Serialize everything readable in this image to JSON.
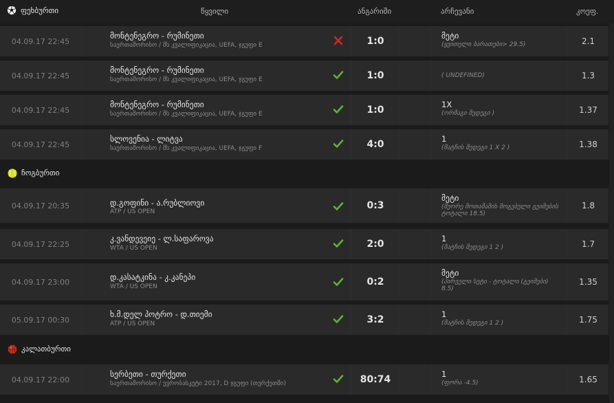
{
  "header": {
    "sport_label": "ფეხბურთი",
    "col_pair": "წყვილი",
    "col_score": "ანგარიში",
    "col_selection": "არჩევანი",
    "col_odd": "კოეფ."
  },
  "colors": {
    "won": "#5cb531",
    "lost": "#d9251d",
    "tennis_ball": "#d7e21a",
    "basketball": "#c7331f"
  },
  "football": [
    {
      "date": "04.09.17 22:45",
      "teams": "მონტენეგრო - რუმინეთი",
      "league": "საერთაშორისო / მს კვალიფიკაცია, UEFA, ჯგუფი E",
      "status": "lost",
      "score": "1:0",
      "sel": "მეტი",
      "desc": "(ყვითელი ბარათები> 29.5)",
      "odd": "2.1"
    },
    {
      "date": "04.09.17 22:45",
      "teams": "მონტენეგრო - რუმინეთი",
      "league": "საერთაშორისო / მს კვალიფიკაცია, UEFA, ჯგუფი E",
      "status": "won",
      "score": "1:0",
      "sel": "",
      "desc": "( UNDEFINED)",
      "odd": "1.3"
    },
    {
      "date": "04.09.17 22:45",
      "teams": "მონტენეგრო - რუმინეთი",
      "league": "საერთაშორისო / მს კვალიფიკაცია, UEFA, ჯგუფი E",
      "status": "won",
      "score": "1:0",
      "sel": "1X",
      "desc": "(ორმაგი შედეგი )",
      "odd": "1.37"
    },
    {
      "date": "04.09.17 22:45",
      "teams": "სლოვენია - ლიტვა",
      "league": "საერთაშორისო / მს კვალიფიკაცია, UEFA, ჯგუფი F",
      "status": "won",
      "score": "4:0",
      "sel": "1",
      "desc": "(მატჩის შედეგი 1 X 2 )",
      "odd": "1.38"
    }
  ],
  "tennis_label": "ჩოგბურთი",
  "tennis": [
    {
      "date": "04.09.17 20:35",
      "teams": "დ.გოფინი - ა.რუბლიოვი",
      "league": "ATP / US OPEN",
      "status": "won",
      "score": "0:3",
      "sel": "მეტი",
      "desc": "(მეორე მოთამაშის მოგებული გეიმების ტოტალი 18.5)",
      "odd": "1.8"
    },
    {
      "date": "04.09.17 22:25",
      "teams": "კ.ვანდევეიე - ლ.საფაროვა",
      "league": "WTA / US OPEN",
      "status": "won",
      "score": "2:0",
      "sel": "1",
      "desc": "(მატჩის შედეგი 1 2 )",
      "odd": "1.7"
    },
    {
      "date": "04.09.17 23:00",
      "teams": "დ.კასატკინა - კ.კანეპი",
      "league": "WTA / US OPEN",
      "status": "won",
      "score": "0:2",
      "sel": "მეტი",
      "desc": "(პირველი სეტი - ტოტალი (გეიმები) 8.5)",
      "odd": "1.35"
    },
    {
      "date": "05.09.17 00:30",
      "teams": "ხ.მ.დელ პოტრო - დ.თიემი",
      "league": "ATP / US OPEN",
      "status": "won",
      "score": "3:2",
      "sel": "1",
      "desc": "(მატჩის შედეგი 1 2 )",
      "odd": "1.75"
    }
  ],
  "basketball_label": "კალათბურთი",
  "basketball": [
    {
      "date": "04.09.17 22:00",
      "teams": "სერბეთი - თურქეთი",
      "league": "საერთაშორისო / ევრობასკეტი 2017, D ჯგუფი (თურქეთში)",
      "status": "won",
      "score": "80:74",
      "sel": "1",
      "desc": "(ფორა -4.5)",
      "odd": "1.65"
    }
  ]
}
